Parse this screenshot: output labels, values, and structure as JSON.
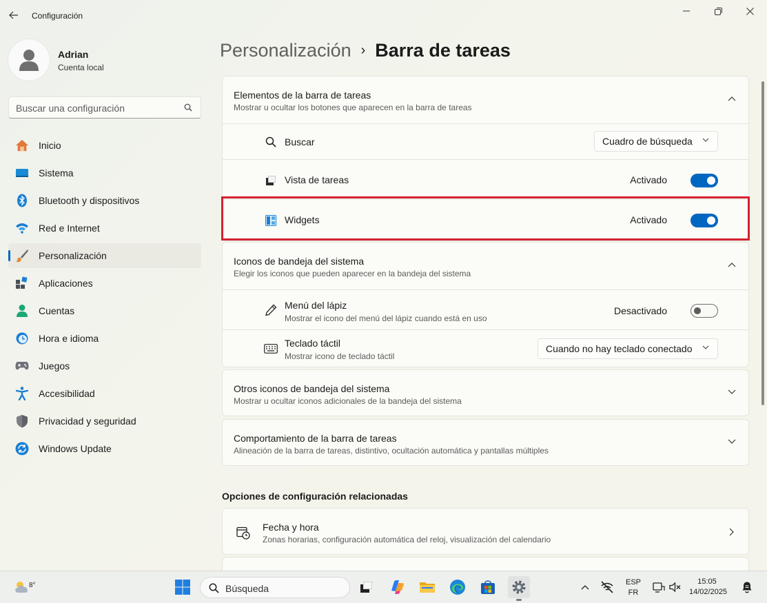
{
  "window": {
    "title": "Configuración",
    "controls": [
      "minimize",
      "maximize",
      "close"
    ]
  },
  "profile": {
    "name": "Adrian",
    "account": "Cuenta local"
  },
  "search": {
    "placeholder": "Buscar una configuración"
  },
  "sidebar": {
    "items": [
      {
        "label": "Inicio",
        "icon": "home-icon",
        "active": false
      },
      {
        "label": "Sistema",
        "icon": "system-icon",
        "active": false
      },
      {
        "label": "Bluetooth y dispositivos",
        "icon": "bluetooth-icon",
        "active": false
      },
      {
        "label": "Red e Internet",
        "icon": "wifi-icon",
        "active": false
      },
      {
        "label": "Personalización",
        "icon": "brush-icon",
        "active": true
      },
      {
        "label": "Aplicaciones",
        "icon": "apps-icon",
        "active": false
      },
      {
        "label": "Cuentas",
        "icon": "accounts-icon",
        "active": false
      },
      {
        "label": "Hora e idioma",
        "icon": "time-language-icon",
        "active": false
      },
      {
        "label": "Juegos",
        "icon": "gamepad-icon",
        "active": false
      },
      {
        "label": "Accesibilidad",
        "icon": "accessibility-icon",
        "active": false
      },
      {
        "label": "Privacidad y seguridad",
        "icon": "shield-icon",
        "active": false
      },
      {
        "label": "Windows Update",
        "icon": "windows-update-icon",
        "active": false
      }
    ]
  },
  "breadcrumb": {
    "parent": "Personalización",
    "separator": "›",
    "current": "Barra de tareas"
  },
  "taskbar_items_card": {
    "title": "Elementos de la barra de tareas",
    "subtitle": "Mostrar u ocultar los botones que aparecen en la barra de tareas",
    "rows": {
      "search": {
        "label": "Buscar",
        "value": "Cuadro de búsqueda"
      },
      "task_view": {
        "label": "Vista de tareas",
        "state": "Activado",
        "on": true
      },
      "widgets": {
        "label": "Widgets",
        "state": "Activado",
        "on": true
      }
    }
  },
  "tray_icons_card": {
    "title": "Iconos de bandeja del sistema",
    "subtitle": "Elegir los iconos que pueden aparecer en la bandeja del sistema",
    "rows": {
      "pen_menu": {
        "label": "Menú del lápiz",
        "sub": "Mostrar el icono del menú del lápiz cuando está en uso",
        "state": "Desactivado",
        "on": false
      },
      "touch_keyboard": {
        "label": "Teclado táctil",
        "sub": "Mostrar icono de teclado táctil",
        "value": "Cuando no hay teclado conectado"
      }
    }
  },
  "other_tray_card": {
    "title": "Otros iconos de bandeja del sistema",
    "subtitle": "Mostrar u ocultar iconos adicionales de la bandeja del sistema"
  },
  "behavior_card": {
    "title": "Comportamiento de la barra de tareas",
    "subtitle": "Alineación de la barra de tareas, distintivo, ocultación automática y pantallas múltiples"
  },
  "related": {
    "title": "Opciones de configuración relacionadas",
    "items": [
      {
        "label": "Fecha y hora",
        "sub": "Zonas horarias, configuración automática del reloj, visualización del calendario"
      }
    ]
  },
  "taskbar": {
    "weather_temp": "8°",
    "search_label": "Búsqueda",
    "language_top": "ESP",
    "language_bottom": "FR",
    "time": "15:05",
    "date": "14/02/2025"
  },
  "colors": {
    "accent": "#0067c0",
    "highlight_box": "#d4212f"
  }
}
